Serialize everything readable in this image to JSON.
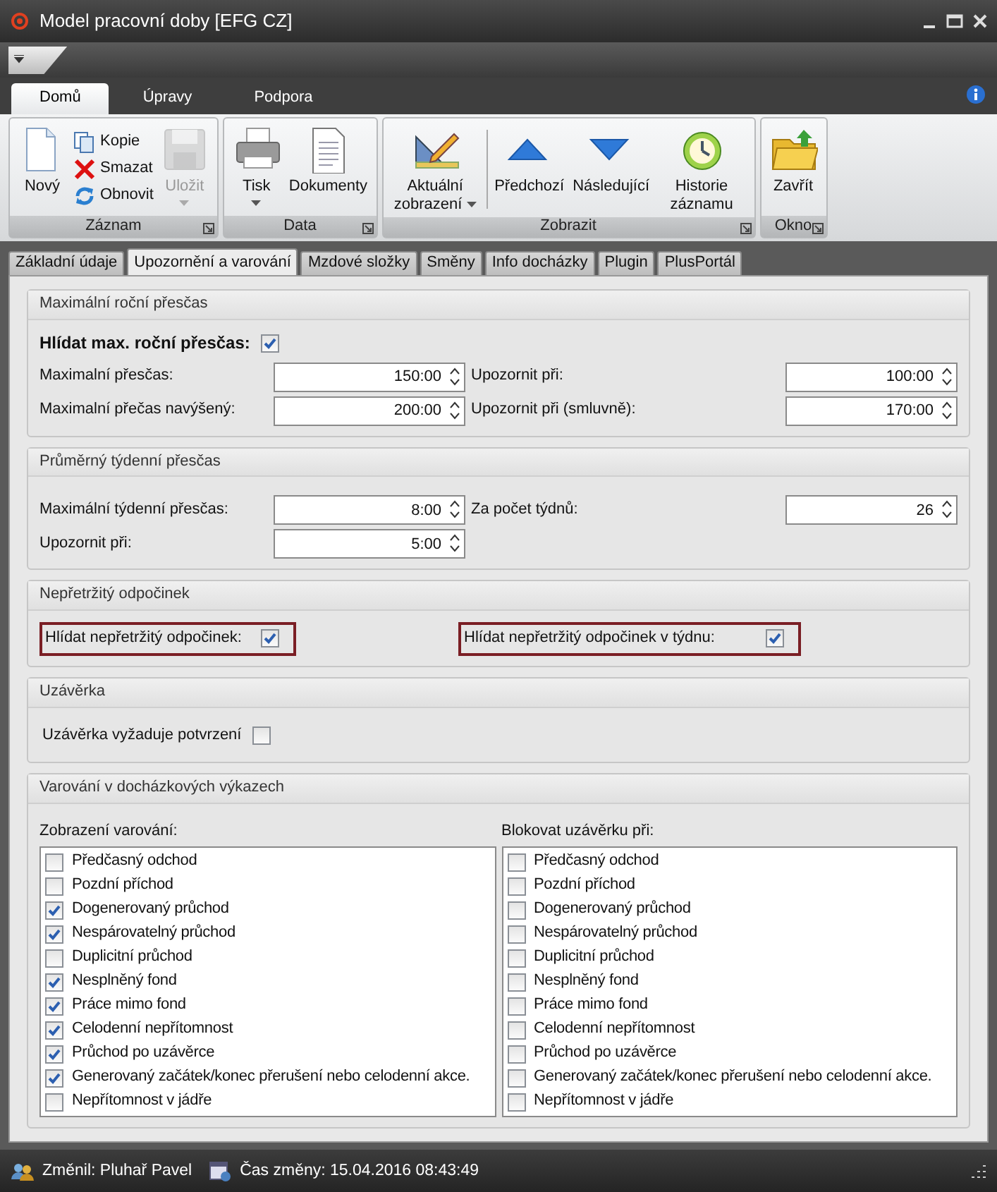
{
  "window": {
    "title": "Model pracovní doby [EFG CZ]"
  },
  "ribbon_tabs": [
    {
      "label": "Domů",
      "selected": true
    },
    {
      "label": "Úpravy",
      "selected": false
    },
    {
      "label": "Podpora",
      "selected": false
    }
  ],
  "ribbon_groups": [
    {
      "label": "Záznam",
      "buttons": [
        {
          "label": "Nový",
          "kind": "large",
          "disabled": false
        },
        {
          "label": "Kopie",
          "kind": "small",
          "disabled": false
        },
        {
          "label": "Smazat",
          "kind": "small",
          "disabled": false
        },
        {
          "label": "Obnovit",
          "kind": "small",
          "disabled": false
        },
        {
          "label": "Uložit",
          "kind": "large",
          "disabled": true,
          "dropdown": true
        }
      ]
    },
    {
      "label": "Data",
      "buttons": [
        {
          "label": "Tisk",
          "kind": "large",
          "disabled": false,
          "dropdown": true
        },
        {
          "label": "Dokumenty",
          "kind": "large",
          "disabled": false
        }
      ]
    },
    {
      "label": "Zobrazit",
      "buttons": [
        {
          "label": "Aktuální zobrazení",
          "kind": "large",
          "disabled": false,
          "dropdown": true
        },
        {
          "kind": "separator"
        },
        {
          "label": "Předchozí",
          "kind": "large",
          "disabled": false
        },
        {
          "label": "Následující",
          "kind": "large",
          "disabled": false
        },
        {
          "label": "Historie záznamu",
          "kind": "large",
          "disabled": false
        }
      ]
    },
    {
      "label": "Okno",
      "buttons": [
        {
          "label": "Zavřít",
          "kind": "large",
          "disabled": false
        }
      ]
    }
  ],
  "doc_tabs": [
    {
      "label": "Základní údaje",
      "selected": false
    },
    {
      "label": "Upozornění a varování",
      "selected": true
    },
    {
      "label": "Mzdové složky",
      "selected": false
    },
    {
      "label": "Směny",
      "selected": false
    },
    {
      "label": "Info docházky",
      "selected": false
    },
    {
      "label": "Plugin",
      "selected": false
    },
    {
      "label": "PlusPortál",
      "selected": false
    }
  ],
  "sections": [
    {
      "title": "Maximální roční přesčas",
      "kind": "fields",
      "check": {
        "label": "Hlídat max. roční přesčas:",
        "checked": true
      },
      "rows": [
        [
          {
            "label": "Maximalní přesčas:",
            "value": "150:00"
          },
          {
            "label": "Upozornit při:",
            "value": "100:00"
          }
        ],
        [
          {
            "label": "Maximalní přečas navýšený:",
            "value": "200:00"
          },
          {
            "label": "Upozornit při (smluvně):",
            "value": "170:00"
          }
        ]
      ]
    },
    {
      "title": "Průměrný týdenní přesčas",
      "kind": "fields",
      "rows": [
        [
          {
            "label": "Maximální týdenní přesčas:",
            "value": "8:00"
          },
          {
            "label": "Za počet týdnů:",
            "value": "26"
          }
        ],
        [
          {
            "label": "Upozornit při:",
            "value": "5:00"
          }
        ]
      ]
    },
    {
      "title": "Nepřetržitý odpočinek",
      "kind": "checks",
      "checks": [
        {
          "label": "Hlídat nepřetržitý odpočinek:",
          "checked": true,
          "highlighted": true
        },
        {
          "label": "Hlídat nepřetržitý odpočinek v týdnu:",
          "checked": true,
          "highlighted": true
        }
      ]
    },
    {
      "title": "Uzávěrka",
      "kind": "checks",
      "checks": [
        {
          "label": "Uzávěrka vyžaduje potvrzení",
          "checked": false,
          "highlighted": false
        }
      ]
    },
    {
      "title": "Varování v docházkových výkazech",
      "kind": "lists",
      "lists": [
        {
          "label": "Zobrazení varování:",
          "items": [
            {
              "label": "Předčasný odchod",
              "checked": false
            },
            {
              "label": "Pozdní příchod",
              "checked": false
            },
            {
              "label": "Dogenerovaný průchod",
              "checked": true
            },
            {
              "label": "Nespárovatelný průchod",
              "checked": true
            },
            {
              "label": "Duplicitní průchod",
              "checked": false
            },
            {
              "label": "Nesplněný fond",
              "checked": true
            },
            {
              "label": "Práce mimo fond",
              "checked": true
            },
            {
              "label": "Celodenní nepřítomnost",
              "checked": true
            },
            {
              "label": "Průchod po uzávěrce",
              "checked": true
            },
            {
              "label": "Generovaný začátek/konec přerušení nebo celodenní akce.",
              "checked": true
            },
            {
              "label": "Nepřítomnost v jádře",
              "checked": false
            }
          ]
        },
        {
          "label": "Blokovat uzávěrku při:",
          "items": [
            {
              "label": "Předčasný odchod",
              "checked": false
            },
            {
              "label": "Pozdní příchod",
              "checked": false
            },
            {
              "label": "Dogenerovaný průchod",
              "checked": false
            },
            {
              "label": "Nespárovatelný průchod",
              "checked": false
            },
            {
              "label": "Duplicitní průchod",
              "checked": false
            },
            {
              "label": "Nesplněný fond",
              "checked": false
            },
            {
              "label": "Práce mimo fond",
              "checked": false
            },
            {
              "label": "Celodenní nepřítomnost",
              "checked": false
            },
            {
              "label": "Průchod po uzávěrce",
              "checked": false
            },
            {
              "label": "Generovaný začátek/konec přerušení nebo celodenní akce.",
              "checked": false
            },
            {
              "label": "Nepřítomnost v jádře",
              "checked": false
            }
          ]
        }
      ]
    }
  ],
  "status_bar": {
    "changed_by": "Změnil: Pluhař Pavel",
    "changed_at": "Čas změny: 15.04.2016 08:43:49"
  }
}
